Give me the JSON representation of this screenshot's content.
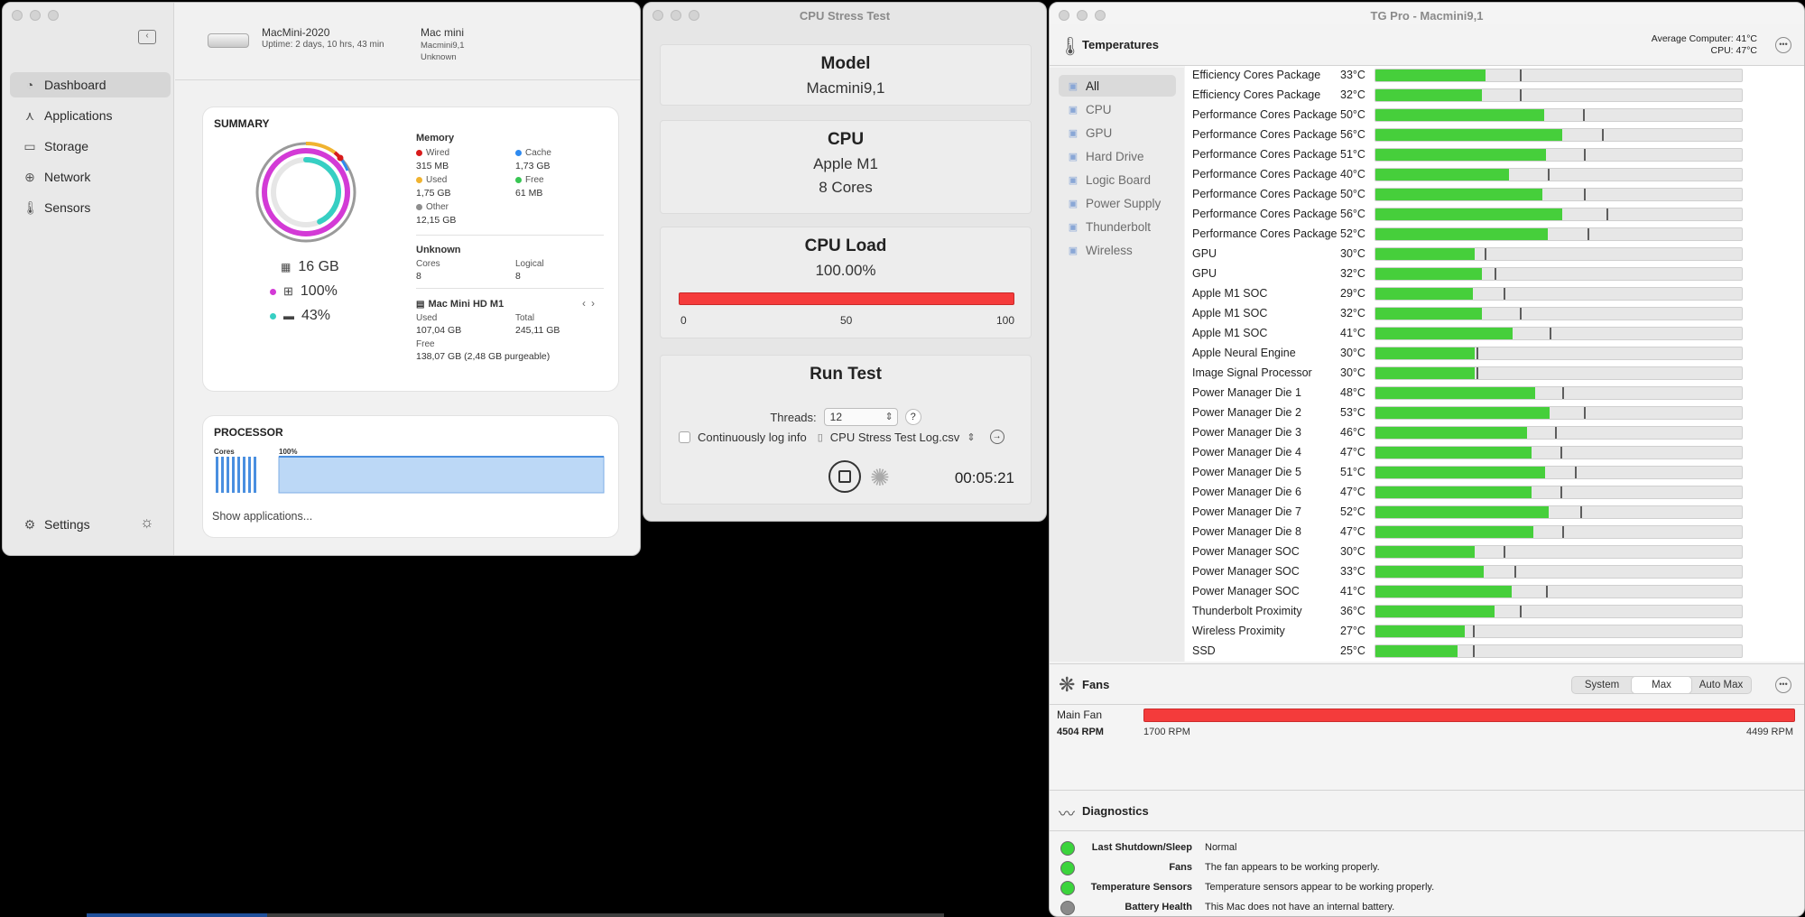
{
  "dashboard": {
    "sidebar": {
      "items": [
        {
          "label": "Dashboard",
          "icon": "speedometer-icon"
        },
        {
          "label": "Applications",
          "icon": "apps-icon"
        },
        {
          "label": "Storage",
          "icon": "drive-icon"
        },
        {
          "label": "Network",
          "icon": "globe-icon"
        },
        {
          "label": "Sensors",
          "icon": "thermometer-icon"
        }
      ],
      "settings_label": "Settings"
    },
    "device": {
      "name": "MacMini-2020",
      "uptime": "Uptime: 2 days, 10 hrs, 43 min",
      "model": "Mac mini",
      "model_id": "Macmini9,1",
      "unknown": "Unknown"
    },
    "summary": {
      "title": "SUMMARY",
      "ram": "16 GB",
      "cpu_pct": "100%",
      "disk_pct": "43%",
      "cpu_level": 1.0,
      "disk_level": 0.43,
      "memory_title": "Memory",
      "memory": [
        {
          "label": "Wired",
          "value": "315 MB",
          "color": "#d81b1b"
        },
        {
          "label": "Cache",
          "value": "1,73 GB",
          "color": "#2e8af0"
        },
        {
          "label": "Used",
          "value": "1,75 GB",
          "color": "#f0b330"
        },
        {
          "label": "Free",
          "value": "61 MB",
          "color": "#38c653"
        },
        {
          "label": "Other",
          "value": "12,15 GB",
          "color": "#8e8e8e"
        }
      ],
      "cpu_title": "Unknown",
      "cores_label": "Cores",
      "cores_value": "8",
      "logical_label": "Logical",
      "logical_value": "8",
      "disk_title": "Mac Mini HD M1",
      "used_label": "Used",
      "used_value": "107,04 GB",
      "total_label": "Total",
      "total_value": "245,11 GB",
      "free_label": "Free",
      "free_value": "138,07 GB (2,48 GB purgeable)"
    },
    "processor": {
      "title": "PROCESSOR",
      "cores_label": "Cores",
      "pct_label": "100%",
      "show_apps": "Show applications..."
    }
  },
  "stress": {
    "title": "CPU Stress Test",
    "model_title": "Model",
    "model_value": "Macmini9,1",
    "cpu_title": "CPU",
    "cpu_value": "Apple M1",
    "cores_value": "8 Cores",
    "load_title": "CPU Load",
    "load_value": "100.00%",
    "load_level": 1.0,
    "ticks": [
      "0",
      "50",
      "100"
    ],
    "run_title": "Run Test",
    "threads_label": "Threads:",
    "threads_value": "12",
    "help": "?",
    "log_label": "Continuously log info",
    "log_file": "CPU Stress Test Log.csv",
    "elapsed": "00:05:21"
  },
  "tgpro": {
    "title": "TG Pro - Macmini9,1",
    "temps_title": "Temperatures",
    "avg_computer_label": "Average Computer:",
    "avg_computer_value": "41°C",
    "avg_cpu_label": "CPU:",
    "avg_cpu_value": "47°C",
    "categories": [
      {
        "label": "All",
        "icon": "grid-icon"
      },
      {
        "label": "CPU",
        "icon": "cpu-icon"
      },
      {
        "label": "GPU",
        "icon": "gpu-icon"
      },
      {
        "label": "Hard Drive",
        "icon": "drive-icon"
      },
      {
        "label": "Logic Board",
        "icon": "board-icon"
      },
      {
        "label": "Power Supply",
        "icon": "power-icon"
      },
      {
        "label": "Thunderbolt",
        "icon": "bolt-icon"
      },
      {
        "label": "Wireless",
        "icon": "wifi-icon"
      }
    ],
    "sensors": [
      {
        "name": "Efficiency Cores Package",
        "value": "33°C",
        "level": 0.3,
        "max": 0.395
      },
      {
        "name": "Efficiency Cores Package",
        "value": "32°C",
        "level": 0.29,
        "max": 0.395
      },
      {
        "name": "Performance Cores Package",
        "value": "50°C",
        "level": 0.46,
        "max": 0.567
      },
      {
        "name": "Performance Cores Package",
        "value": "56°C",
        "level": 0.51,
        "max": 0.619
      },
      {
        "name": "Performance Cores Package",
        "value": "51°C",
        "level": 0.465,
        "max": 0.57
      },
      {
        "name": "Performance Cores Package",
        "value": "40°C",
        "level": 0.365,
        "max": 0.47
      },
      {
        "name": "Performance Cores Package",
        "value": "50°C",
        "level": 0.455,
        "max": 0.57
      },
      {
        "name": "Performance Cores Package",
        "value": "56°C",
        "level": 0.51,
        "max": 0.63
      },
      {
        "name": "Performance Cores Package",
        "value": "52°C",
        "level": 0.47,
        "max": 0.58
      },
      {
        "name": "GPU",
        "value": "30°C",
        "level": 0.27,
        "max": 0.297
      },
      {
        "name": "GPU",
        "value": "32°C",
        "level": 0.29,
        "max": 0.325
      },
      {
        "name": "Apple M1 SOC",
        "value": "29°C",
        "level": 0.265,
        "max": 0.35
      },
      {
        "name": "Apple M1 SOC",
        "value": "32°C",
        "level": 0.29,
        "max": 0.395
      },
      {
        "name": "Apple M1 SOC",
        "value": "41°C",
        "level": 0.375,
        "max": 0.475
      },
      {
        "name": "Apple Neural Engine",
        "value": "30°C",
        "level": 0.27,
        "max": 0.275
      },
      {
        "name": "Image Signal Processor",
        "value": "30°C",
        "level": 0.27,
        "max": 0.275
      },
      {
        "name": "Power Manager Die 1",
        "value": "48°C",
        "level": 0.435,
        "max": 0.51
      },
      {
        "name": "Power Manager Die 2",
        "value": "53°C",
        "level": 0.475,
        "max": 0.57
      },
      {
        "name": "Power Manager Die 3",
        "value": "46°C",
        "level": 0.415,
        "max": 0.49
      },
      {
        "name": "Power Manager Die 4",
        "value": "47°C",
        "level": 0.427,
        "max": 0.505
      },
      {
        "name": "Power Manager Die 5",
        "value": "51°C",
        "level": 0.462,
        "max": 0.545
      },
      {
        "name": "Power Manager Die 6",
        "value": "47°C",
        "level": 0.427,
        "max": 0.505
      },
      {
        "name": "Power Manager Die 7",
        "value": "52°C",
        "level": 0.473,
        "max": 0.56
      },
      {
        "name": "Power Manager Die 8",
        "value": "47°C",
        "level": 0.43,
        "max": 0.51
      },
      {
        "name": "Power Manager SOC",
        "value": "30°C",
        "level": 0.27,
        "max": 0.35
      },
      {
        "name": "Power Manager SOC",
        "value": "33°C",
        "level": 0.295,
        "max": 0.38
      },
      {
        "name": "Power Manager SOC",
        "value": "41°C",
        "level": 0.372,
        "max": 0.465
      },
      {
        "name": "Thunderbolt Proximity",
        "value": "36°C",
        "level": 0.325,
        "max": 0.395
      },
      {
        "name": "Wireless Proximity",
        "value": "27°C",
        "level": 0.245,
        "max": 0.265
      },
      {
        "name": "SSD",
        "value": "25°C",
        "level": 0.225,
        "max": 0.265
      }
    ],
    "fans_title": "Fans",
    "fan_modes": [
      "System",
      "Max",
      "Auto Max"
    ],
    "fan_mode_active": "Max",
    "fan_name": "Main Fan",
    "fan_rpm": "4504 RPM",
    "fan_min": "1700 RPM",
    "fan_max": "4499 RPM",
    "fan_level": 1.0,
    "diagnostics_title": "Diagnostics",
    "diagnostics": [
      {
        "label": "Last Shutdown/Sleep",
        "text": "Normal",
        "color": "#3bd43c"
      },
      {
        "label": "Fans",
        "text": "The fan appears to be working properly.",
        "color": "#3bd43c"
      },
      {
        "label": "Temperature Sensors",
        "text": "Temperature sensors appear to be working properly.",
        "color": "#3bd43c"
      },
      {
        "label": "Battery Health",
        "text": "This Mac does not have an internal battery.",
        "color": "#8a8a8a"
      }
    ]
  }
}
